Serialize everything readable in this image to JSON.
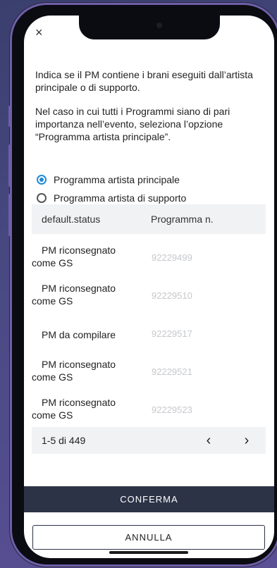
{
  "close_label": "×",
  "description": {
    "paragraph1": "Indica se il PM contiene i brani eseguiti dall’artista principale o di supporto.",
    "paragraph2": "Nel caso in cui tutti i Programmi siano di pari importanza nell’evento, seleziona l’opzione “Programma artista principale”."
  },
  "options": [
    {
      "label": "Programma artista principale",
      "checked": true
    },
    {
      "label": "Programma artista di supporto",
      "checked": false
    }
  ],
  "table": {
    "headers": [
      "default.status",
      "Programma n."
    ],
    "rows": [
      {
        "status": "PM riconsegnato come GS",
        "number": "92229499"
      },
      {
        "status": "PM riconsegnato come GS",
        "number": "92229510"
      },
      {
        "status": "PM da compilare",
        "number": "92229517"
      },
      {
        "status": "PM riconsegnato come GS",
        "number": "92229521"
      },
      {
        "status": "PM riconsegnato come GS",
        "number": "92229523"
      }
    ],
    "pagination": {
      "range": "1-5 di 449",
      "prev": "‹",
      "next": "›"
    }
  },
  "buttons": {
    "confirm": "CONFERMA",
    "cancel": "ANNULLA"
  },
  "colors": {
    "accent": "#1f8bd6",
    "primary_button": "#2d3347",
    "number_text": "#c6c8cc"
  }
}
